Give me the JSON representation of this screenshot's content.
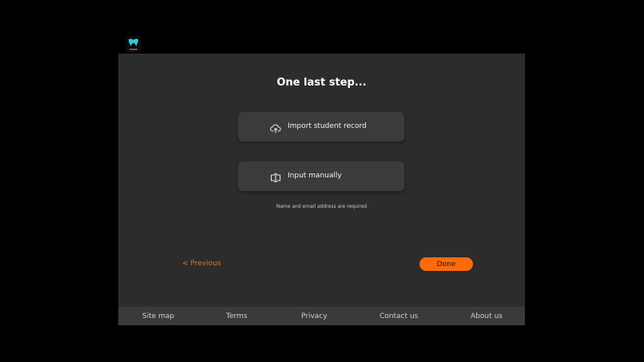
{
  "app": {
    "logo_icon": "tooth-logo-icon"
  },
  "main": {
    "title": "One last step...",
    "options": [
      {
        "label": "Import student record",
        "icon": "cloud-upload-icon"
      },
      {
        "label": "Input manually",
        "icon": "text-cursor-input-icon"
      }
    ],
    "helper_text": "Name and email address are required"
  },
  "nav": {
    "previous_label": "< Previous",
    "done_label": "Done"
  },
  "footer": {
    "links": [
      "Site map",
      "Terms",
      "Privacy",
      "Contact us",
      "About us"
    ]
  },
  "colors": {
    "background": "#000000",
    "panel": "#2c2c2c",
    "card": "#3b3b3b",
    "footer": "#3a3a3a",
    "accent": "#fd6a0a"
  }
}
